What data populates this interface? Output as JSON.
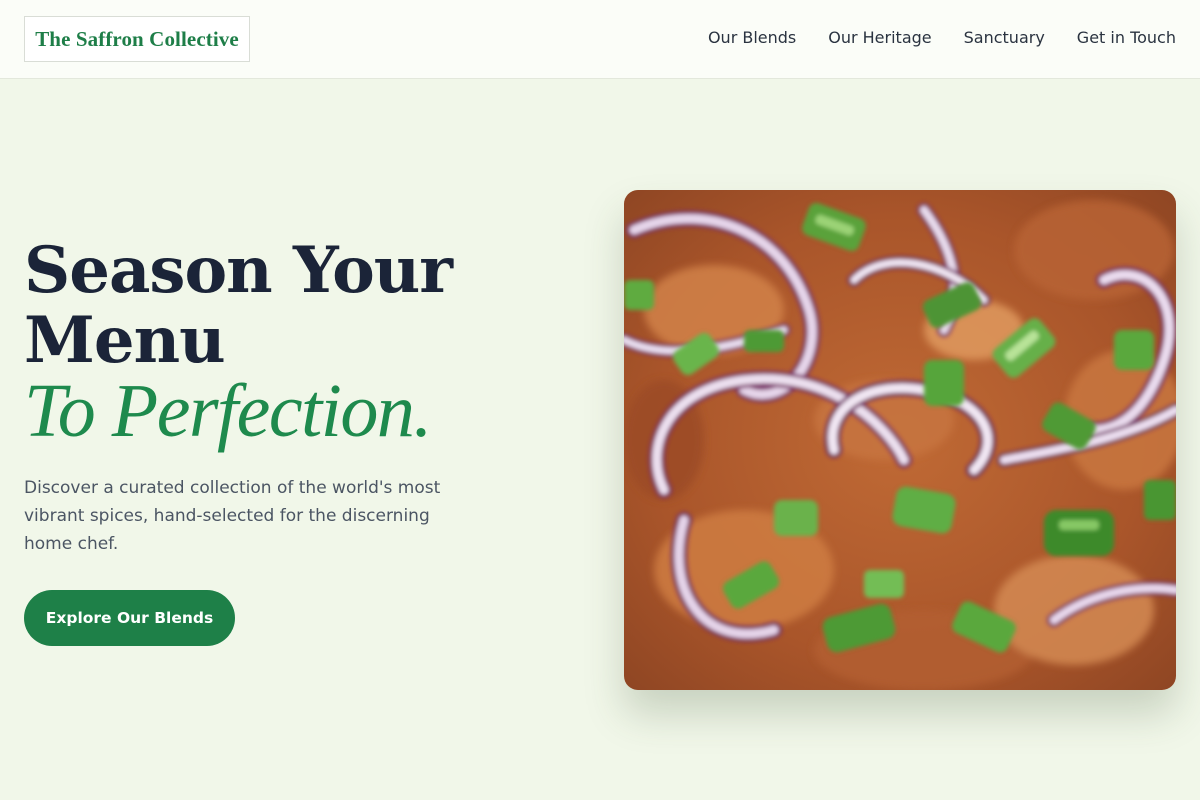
{
  "brand": {
    "name": "The Saffron Collective"
  },
  "nav": {
    "items": [
      {
        "label": "Our Blends"
      },
      {
        "label": "Our Heritage"
      },
      {
        "label": "Sanctuary"
      },
      {
        "label": "Get in Touch"
      }
    ]
  },
  "hero": {
    "headline_line1": "Season Your",
    "headline_line2": "Menu",
    "headline_accent": "To Perfection.",
    "description": "Discover a curated collection of the world's most vibrant spices, hand-selected for the discerning home chef.",
    "cta_label": "Explore Our Blends",
    "image_subject": "dish topped with sliced red onion and green onion"
  },
  "colors": {
    "page_background": "#f1f7e9",
    "header_background": "#fbfdf8",
    "accent_green": "#1e8a4d",
    "button_green": "#1e8048",
    "headline_navy": "#1b2438",
    "body_text": "#4b5563"
  }
}
